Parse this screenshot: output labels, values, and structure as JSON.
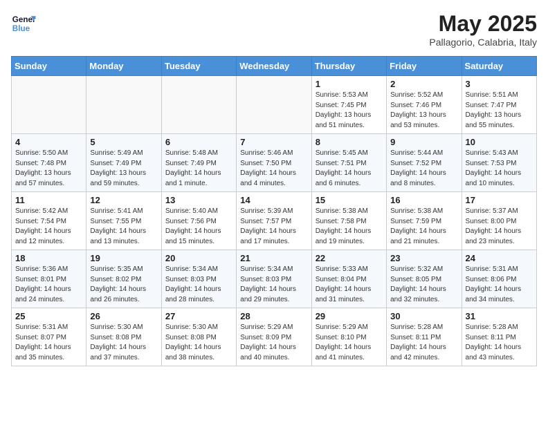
{
  "header": {
    "logo_line1": "General",
    "logo_line2": "Blue",
    "month": "May 2025",
    "location": "Pallagorio, Calabria, Italy"
  },
  "days_of_week": [
    "Sunday",
    "Monday",
    "Tuesday",
    "Wednesday",
    "Thursday",
    "Friday",
    "Saturday"
  ],
  "weeks": [
    [
      {
        "day": "",
        "info": ""
      },
      {
        "day": "",
        "info": ""
      },
      {
        "day": "",
        "info": ""
      },
      {
        "day": "",
        "info": ""
      },
      {
        "day": "1",
        "info": "Sunrise: 5:53 AM\nSunset: 7:45 PM\nDaylight: 13 hours\nand 51 minutes."
      },
      {
        "day": "2",
        "info": "Sunrise: 5:52 AM\nSunset: 7:46 PM\nDaylight: 13 hours\nand 53 minutes."
      },
      {
        "day": "3",
        "info": "Sunrise: 5:51 AM\nSunset: 7:47 PM\nDaylight: 13 hours\nand 55 minutes."
      }
    ],
    [
      {
        "day": "4",
        "info": "Sunrise: 5:50 AM\nSunset: 7:48 PM\nDaylight: 13 hours\nand 57 minutes."
      },
      {
        "day": "5",
        "info": "Sunrise: 5:49 AM\nSunset: 7:49 PM\nDaylight: 13 hours\nand 59 minutes."
      },
      {
        "day": "6",
        "info": "Sunrise: 5:48 AM\nSunset: 7:49 PM\nDaylight: 14 hours\nand 1 minute."
      },
      {
        "day": "7",
        "info": "Sunrise: 5:46 AM\nSunset: 7:50 PM\nDaylight: 14 hours\nand 4 minutes."
      },
      {
        "day": "8",
        "info": "Sunrise: 5:45 AM\nSunset: 7:51 PM\nDaylight: 14 hours\nand 6 minutes."
      },
      {
        "day": "9",
        "info": "Sunrise: 5:44 AM\nSunset: 7:52 PM\nDaylight: 14 hours\nand 8 minutes."
      },
      {
        "day": "10",
        "info": "Sunrise: 5:43 AM\nSunset: 7:53 PM\nDaylight: 14 hours\nand 10 minutes."
      }
    ],
    [
      {
        "day": "11",
        "info": "Sunrise: 5:42 AM\nSunset: 7:54 PM\nDaylight: 14 hours\nand 12 minutes."
      },
      {
        "day": "12",
        "info": "Sunrise: 5:41 AM\nSunset: 7:55 PM\nDaylight: 14 hours\nand 13 minutes."
      },
      {
        "day": "13",
        "info": "Sunrise: 5:40 AM\nSunset: 7:56 PM\nDaylight: 14 hours\nand 15 minutes."
      },
      {
        "day": "14",
        "info": "Sunrise: 5:39 AM\nSunset: 7:57 PM\nDaylight: 14 hours\nand 17 minutes."
      },
      {
        "day": "15",
        "info": "Sunrise: 5:38 AM\nSunset: 7:58 PM\nDaylight: 14 hours\nand 19 minutes."
      },
      {
        "day": "16",
        "info": "Sunrise: 5:38 AM\nSunset: 7:59 PM\nDaylight: 14 hours\nand 21 minutes."
      },
      {
        "day": "17",
        "info": "Sunrise: 5:37 AM\nSunset: 8:00 PM\nDaylight: 14 hours\nand 23 minutes."
      }
    ],
    [
      {
        "day": "18",
        "info": "Sunrise: 5:36 AM\nSunset: 8:01 PM\nDaylight: 14 hours\nand 24 minutes."
      },
      {
        "day": "19",
        "info": "Sunrise: 5:35 AM\nSunset: 8:02 PM\nDaylight: 14 hours\nand 26 minutes."
      },
      {
        "day": "20",
        "info": "Sunrise: 5:34 AM\nSunset: 8:03 PM\nDaylight: 14 hours\nand 28 minutes."
      },
      {
        "day": "21",
        "info": "Sunrise: 5:34 AM\nSunset: 8:03 PM\nDaylight: 14 hours\nand 29 minutes."
      },
      {
        "day": "22",
        "info": "Sunrise: 5:33 AM\nSunset: 8:04 PM\nDaylight: 14 hours\nand 31 minutes."
      },
      {
        "day": "23",
        "info": "Sunrise: 5:32 AM\nSunset: 8:05 PM\nDaylight: 14 hours\nand 32 minutes."
      },
      {
        "day": "24",
        "info": "Sunrise: 5:31 AM\nSunset: 8:06 PM\nDaylight: 14 hours\nand 34 minutes."
      }
    ],
    [
      {
        "day": "25",
        "info": "Sunrise: 5:31 AM\nSunset: 8:07 PM\nDaylight: 14 hours\nand 35 minutes."
      },
      {
        "day": "26",
        "info": "Sunrise: 5:30 AM\nSunset: 8:08 PM\nDaylight: 14 hours\nand 37 minutes."
      },
      {
        "day": "27",
        "info": "Sunrise: 5:30 AM\nSunset: 8:08 PM\nDaylight: 14 hours\nand 38 minutes."
      },
      {
        "day": "28",
        "info": "Sunrise: 5:29 AM\nSunset: 8:09 PM\nDaylight: 14 hours\nand 40 minutes."
      },
      {
        "day": "29",
        "info": "Sunrise: 5:29 AM\nSunset: 8:10 PM\nDaylight: 14 hours\nand 41 minutes."
      },
      {
        "day": "30",
        "info": "Sunrise: 5:28 AM\nSunset: 8:11 PM\nDaylight: 14 hours\nand 42 minutes."
      },
      {
        "day": "31",
        "info": "Sunrise: 5:28 AM\nSunset: 8:11 PM\nDaylight: 14 hours\nand 43 minutes."
      }
    ]
  ]
}
